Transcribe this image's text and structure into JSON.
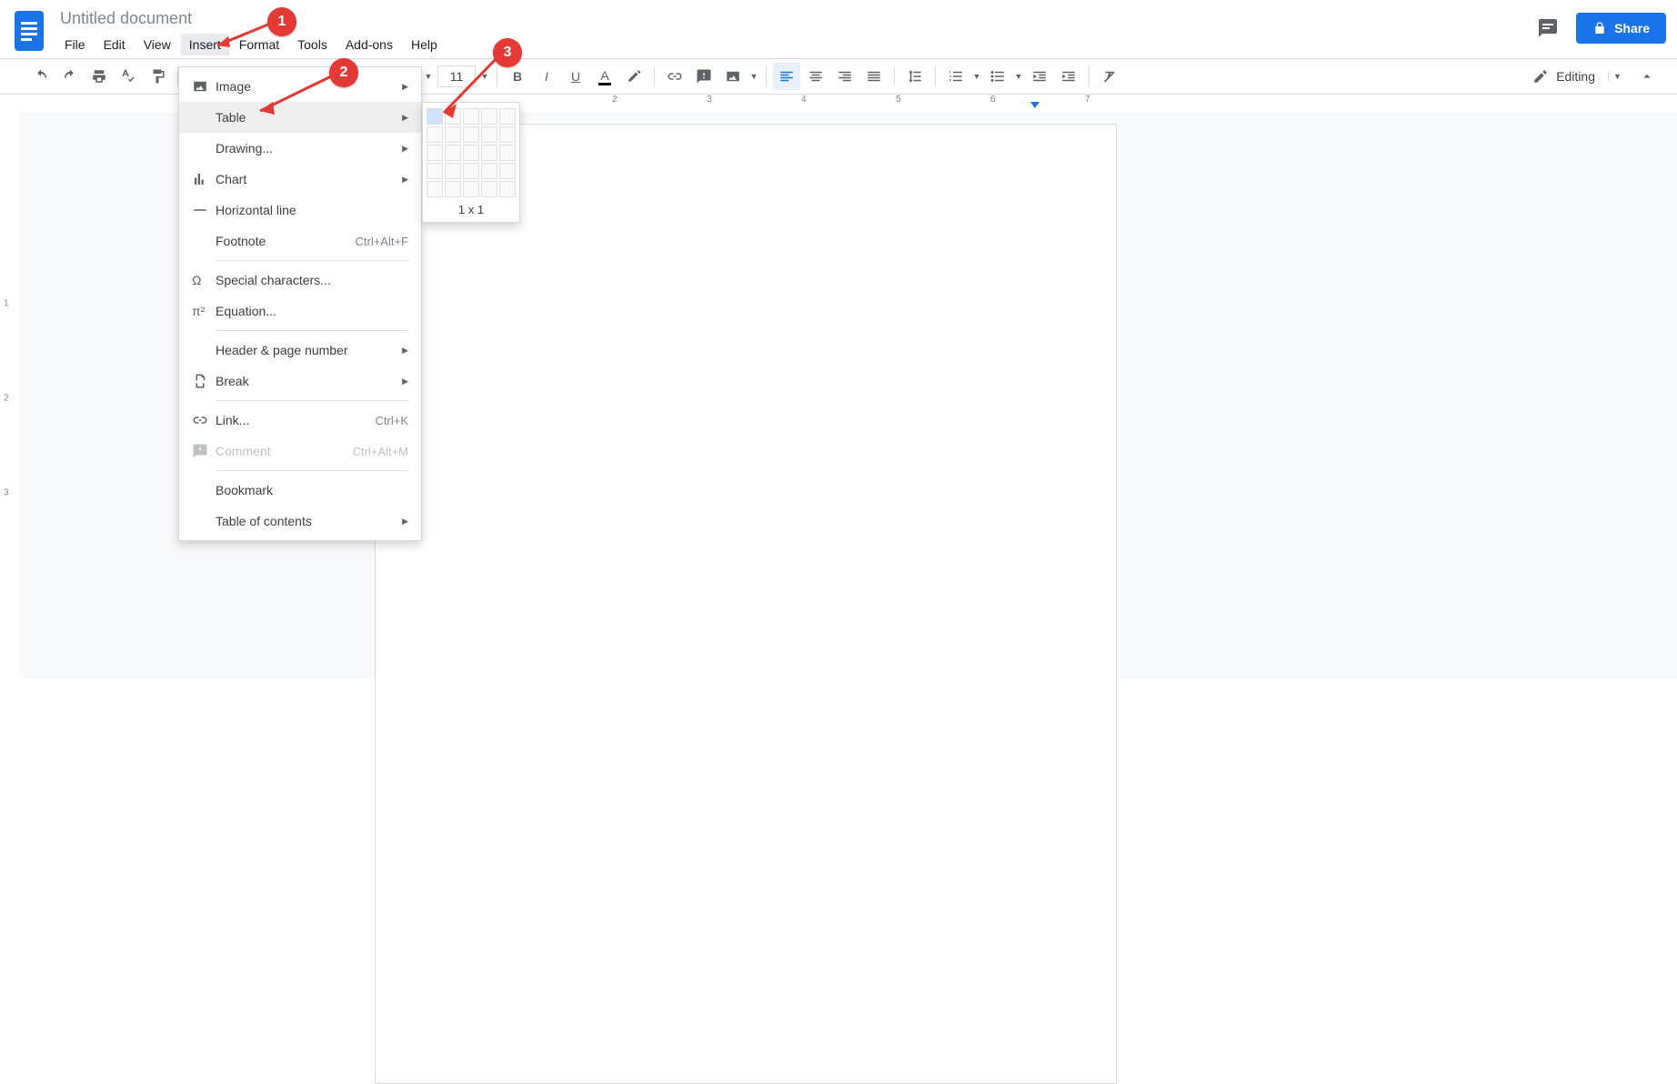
{
  "doc": {
    "title": "Untitled document"
  },
  "menubar": {
    "file": "File",
    "edit": "Edit",
    "view": "View",
    "insert": "Insert",
    "format": "Format",
    "tools": "Tools",
    "addons": "Add-ons",
    "help": "Help"
  },
  "header": {
    "share_label": "Share"
  },
  "toolbar": {
    "font_size": "11",
    "editing_label": "Editing"
  },
  "insert_menu": {
    "image": "Image",
    "table": "Table",
    "drawing": "Drawing...",
    "chart": "Chart",
    "hr": "Horizontal line",
    "footnote": "Footnote",
    "footnote_shortcut": "Ctrl+Alt+F",
    "special": "Special characters...",
    "equation": "Equation...",
    "header_page": "Header & page number",
    "break": "Break",
    "link": "Link...",
    "link_shortcut": "Ctrl+K",
    "comment": "Comment",
    "comment_shortcut": "Ctrl+Alt+M",
    "bookmark": "Bookmark",
    "toc": "Table of contents"
  },
  "table_picker": {
    "label": "1 x 1"
  },
  "ruler": {
    "n2": "2",
    "n3": "3",
    "n4": "4",
    "n5": "5",
    "n6": "6",
    "n7": "7"
  },
  "vruler": {
    "n1": "1",
    "n2": "2",
    "n3": "3"
  },
  "annotations": {
    "b1": "1",
    "b2": "2",
    "b3": "3"
  }
}
